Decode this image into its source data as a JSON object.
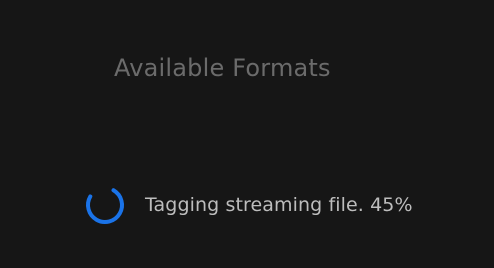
{
  "dialog": {
    "title": "Available Formats",
    "status": {
      "text": "Tagging streaming file. 45%",
      "progress_percent": 45
    }
  },
  "colors": {
    "background": "#161616",
    "title": "#6b6b6b",
    "status_text": "#bdbdbd",
    "spinner": "#1a73e8"
  },
  "icons": {
    "spinner": "loading-spinner-icon"
  }
}
